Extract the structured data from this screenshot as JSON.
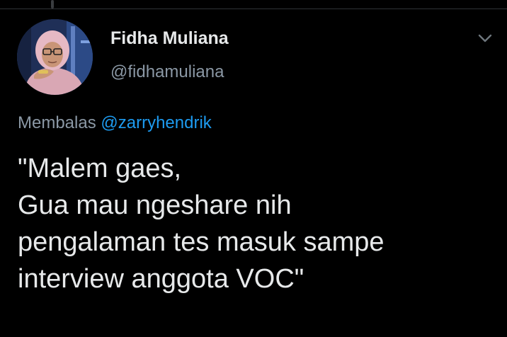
{
  "tweet": {
    "author": {
      "display_name": "Fidha Muliana",
      "handle": "@fidhamuliana",
      "avatar_icon": "profile-photo"
    },
    "menu_icon": "chevron-down-icon",
    "reply": {
      "prefix": "Membalas",
      "mention": "@zarryhendrik"
    },
    "text_lines": [
      "\"Malem gaes,",
      "Gua mau ngeshare nih",
      "pengalaman tes masuk sampe",
      "interview anggota VOC\""
    ]
  },
  "colors": {
    "background": "#000000",
    "primary_text": "#e7e9ea",
    "secondary_text": "#8b98a5",
    "accent": "#1d9bf0"
  }
}
